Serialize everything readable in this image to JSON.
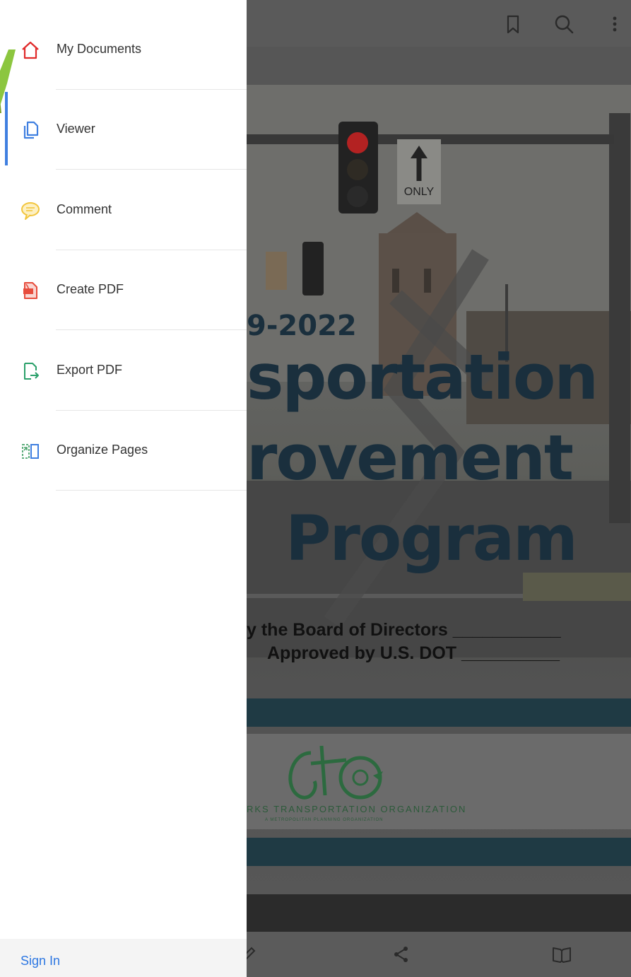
{
  "drawer": {
    "items": [
      {
        "label": "My Documents",
        "icon": "home-icon",
        "color": "#e02a2a"
      },
      {
        "label": "Viewer",
        "icon": "viewer-icon",
        "color": "#3f7fe0",
        "active": true
      },
      {
        "label": "Comment",
        "icon": "comment-icon",
        "color": "#f2c53d"
      },
      {
        "label": "Create PDF",
        "icon": "create-pdf-icon",
        "color": "#e74c3c"
      },
      {
        "label": "Export PDF",
        "icon": "export-pdf-icon",
        "color": "#2aa06a"
      },
      {
        "label": "Organize Pages",
        "icon": "organize-pages-icon",
        "color": "#4aa36c"
      }
    ],
    "sign_in": "Sign In",
    "accent_color": "#8cc63f"
  },
  "document": {
    "year_fragment": "9-2022",
    "title_line_1": "sportation",
    "title_line_2": "rovement",
    "title_line_3": "Program",
    "approved_board": "y the Board of Directors ___________",
    "approved_dot": "Approved by U.S. DOT __________",
    "org_name": "RKS TRANSPORTATION ORGANIZATION",
    "org_sub": "A METROPOLITAN PLANNING ORGANIZATION",
    "sign_text": "ONLY"
  },
  "toolbar": {
    "icons": [
      "bookmark-icon",
      "search-icon",
      "more-icon"
    ]
  },
  "bottom_toolbar": {
    "icons": [
      "edit-icon",
      "share-icon",
      "reading-mode-icon"
    ]
  }
}
